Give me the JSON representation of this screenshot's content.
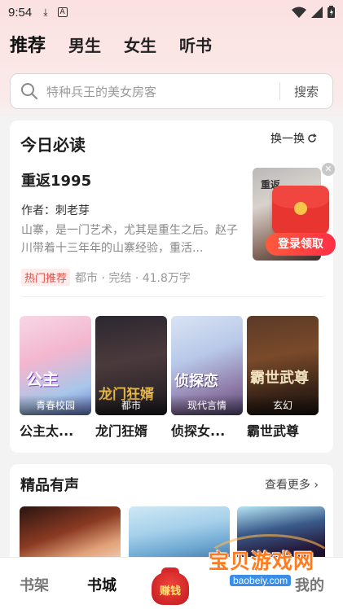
{
  "status_bar": {
    "time": "9:54"
  },
  "top_tabs": [
    {
      "label": "推荐",
      "active": true
    },
    {
      "label": "男生",
      "active": false
    },
    {
      "label": "女生",
      "active": false
    },
    {
      "label": "听书",
      "active": false
    }
  ],
  "search": {
    "placeholder": "特种兵王的美女房客",
    "button": "搜索"
  },
  "today": {
    "title": "今日必读",
    "refresh": "换一换",
    "featured": {
      "title": "重返1995",
      "author": "作者：刺老芽",
      "desc": "山寨，是一门艺术，尤其是重生之后。赵子川带着十三年年的山寨经验，重活...",
      "tag": "热门推荐",
      "meta": "都市 · 完结 · 41.8万字",
      "cover_text": "重返"
    },
    "books": [
      {
        "name": "公主太...",
        "genre": "青春校园",
        "art": "公主"
      },
      {
        "name": "龙门狂婿",
        "genre": "都市",
        "art": "龙门狂婿"
      },
      {
        "name": "侦探女...",
        "genre": "现代言情",
        "art": "侦探恋"
      },
      {
        "name": "霸世武尊",
        "genre": "玄幻",
        "art": "霸世武尊"
      }
    ]
  },
  "promo": {
    "label": "登录领取"
  },
  "audio": {
    "title": "精品有声",
    "more": "查看更多"
  },
  "bottom_nav": [
    {
      "label": "书架",
      "active": false
    },
    {
      "label": "书城",
      "active": true
    },
    {
      "label": "赚钱",
      "active": false
    },
    {
      "label": "我的",
      "active": false
    }
  ],
  "watermark": {
    "text": "宝贝游戏网",
    "url": "baobeiy.com"
  },
  "colors": {
    "accent": "#e24b44",
    "promo": "#ff3b3f",
    "watermark": "#ff7b1f"
  }
}
